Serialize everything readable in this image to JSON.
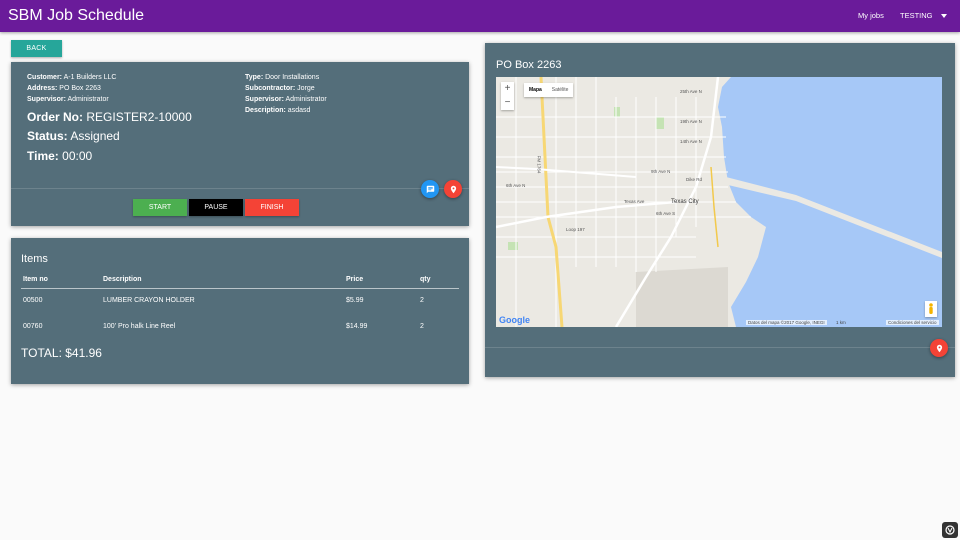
{
  "header": {
    "title": "SBM Job Schedule",
    "nav_myjobs": "My jobs",
    "nav_user": "TESTING"
  },
  "back_label": "BACK",
  "order": {
    "customer_label": "Customer:",
    "customer": "A-1 Builders LLC",
    "address_label": "Address:",
    "address": "PO Box 2263",
    "supervisor_label": "Supervisor:",
    "supervisor": "Administrator",
    "type_label": "Type:",
    "type": "Door Installations",
    "subcontractor_label": "Subcontractor:",
    "subcontractor": "Jorge",
    "supervisor2_label": "Supervisor:",
    "supervisor2": "Administrator",
    "description_label": "Description:",
    "description": "asdasd",
    "order_no_label": "Order No:",
    "order_no": "REGISTER2-10000",
    "status_label": "Status:",
    "status": "Assigned",
    "time_label": "Time:",
    "time": "00:00",
    "start_label": "START",
    "pause_label": "PAUSE",
    "finish_label": "FINISH"
  },
  "items": {
    "title": "Items",
    "columns": [
      "Item no",
      "Description",
      "Price",
      "qty"
    ],
    "rows": [
      {
        "item_no": "00500",
        "description": "LUMBER CRAYON HOLDER",
        "price": "$5.99",
        "qty": "2"
      },
      {
        "item_no": "00760",
        "description": "100' Pro halk Line Reel",
        "price": "$14.99",
        "qty": "2"
      }
    ],
    "total": "TOTAL: $41.96"
  },
  "map": {
    "title": "PO Box 2263",
    "zoom_in": "+",
    "zoom_out": "−",
    "type_map": "Mapa",
    "type_satellite": "Satélite",
    "google": "Google",
    "attribution": "Datos del mapa ©2017 Google, INEGI",
    "scale": "1 km",
    "terms": "Condiciones del servicio",
    "city": "Texas City",
    "labels": {
      "l1": "25th Ave N",
      "l2": "19th Ave N",
      "l3": "14th Ave N",
      "l4": "9th Ave N",
      "l5": "6th Ave N",
      "l6": "Texas Ave",
      "l7": "6th Ave S",
      "l8": "Loop 197",
      "l9": "FM 1764",
      "l10": "Dike Rd"
    }
  },
  "colors": {
    "appbar": "#6a1b9a",
    "card": "#546e7a",
    "back": "#26a69a",
    "start": "#4caf50",
    "pause": "#000000",
    "finish": "#f44336",
    "chat_fab": "#2196f3",
    "location_fab": "#f44336",
    "water": "#a6c8f7"
  },
  "icons": {
    "chat_fab": "chat-icon",
    "location_fab": "location-pin-icon",
    "dropdown": "caret-down-icon",
    "pegman": "pegman-icon"
  }
}
